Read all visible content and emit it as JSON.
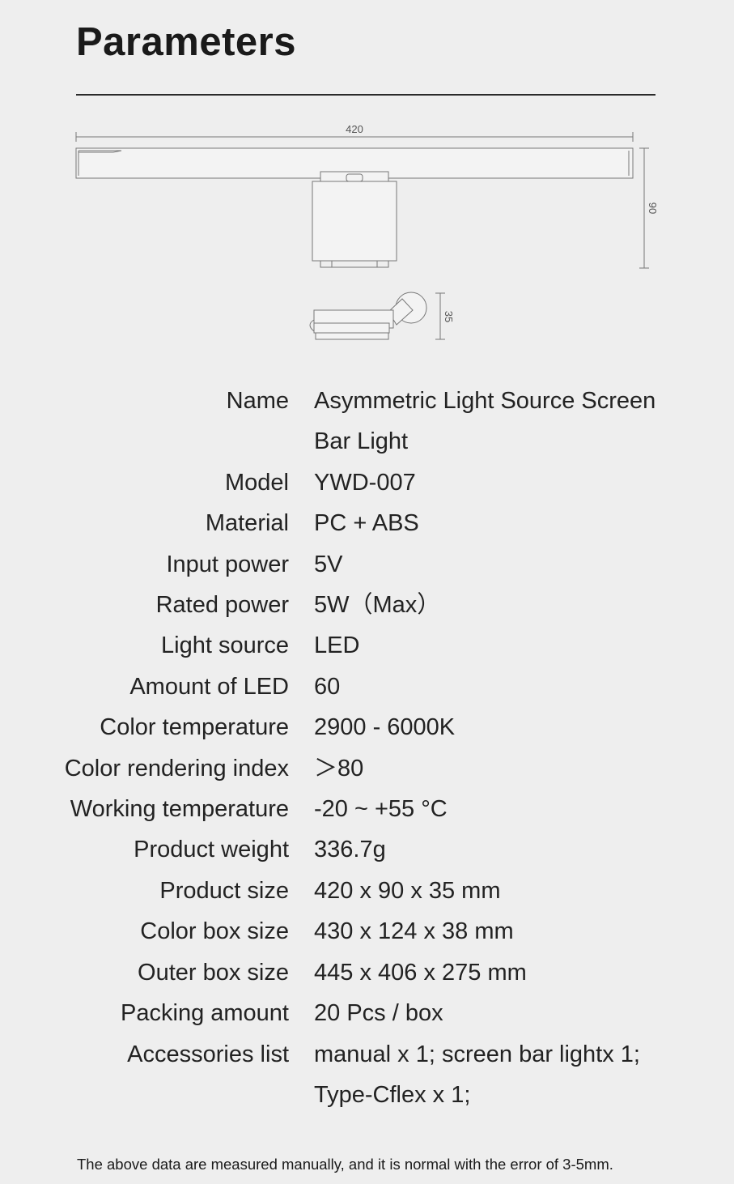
{
  "page": {
    "title": "Parameters"
  },
  "diagram": {
    "width_label": "420",
    "height_label": "90",
    "depth_label": "35"
  },
  "specs": [
    {
      "label": "Name",
      "value": "Asymmetric Light Source Screen Bar Light"
    },
    {
      "label": "Model",
      "value": "YWD-007"
    },
    {
      "label": "Material",
      "value": "PC + ABS"
    },
    {
      "label": "Input power",
      "value": "5V"
    },
    {
      "label": "Rated power",
      "value": "5W（Max）"
    },
    {
      "label": "Light source",
      "value": "LED"
    },
    {
      "label": "Amount of LED",
      "value": "60"
    },
    {
      "label": "Color temperature",
      "value": "2900 - 6000K"
    },
    {
      "label": "Color rendering index",
      "value": "＞80"
    },
    {
      "label": "Working temperature",
      "value": "-20 ~ +55 °C"
    },
    {
      "label": "Product weight",
      "value": "336.7g"
    },
    {
      "label": "Product size",
      "value": "420 x 90 x 35 mm"
    },
    {
      "label": "Color box size",
      "value": "430 x 124 x 38 mm"
    },
    {
      "label": "Outer box size",
      "value": "445 x 406 x 275 mm"
    },
    {
      "label": "Packing amount",
      "value": "20 Pcs / box"
    },
    {
      "label": "Accessories list",
      "value": "manual x 1; screen bar lightx 1; Type-Cflex x 1;"
    }
  ],
  "footer": {
    "note": "The above data are measured manually, and it is normal with the error of 3-5mm."
  }
}
